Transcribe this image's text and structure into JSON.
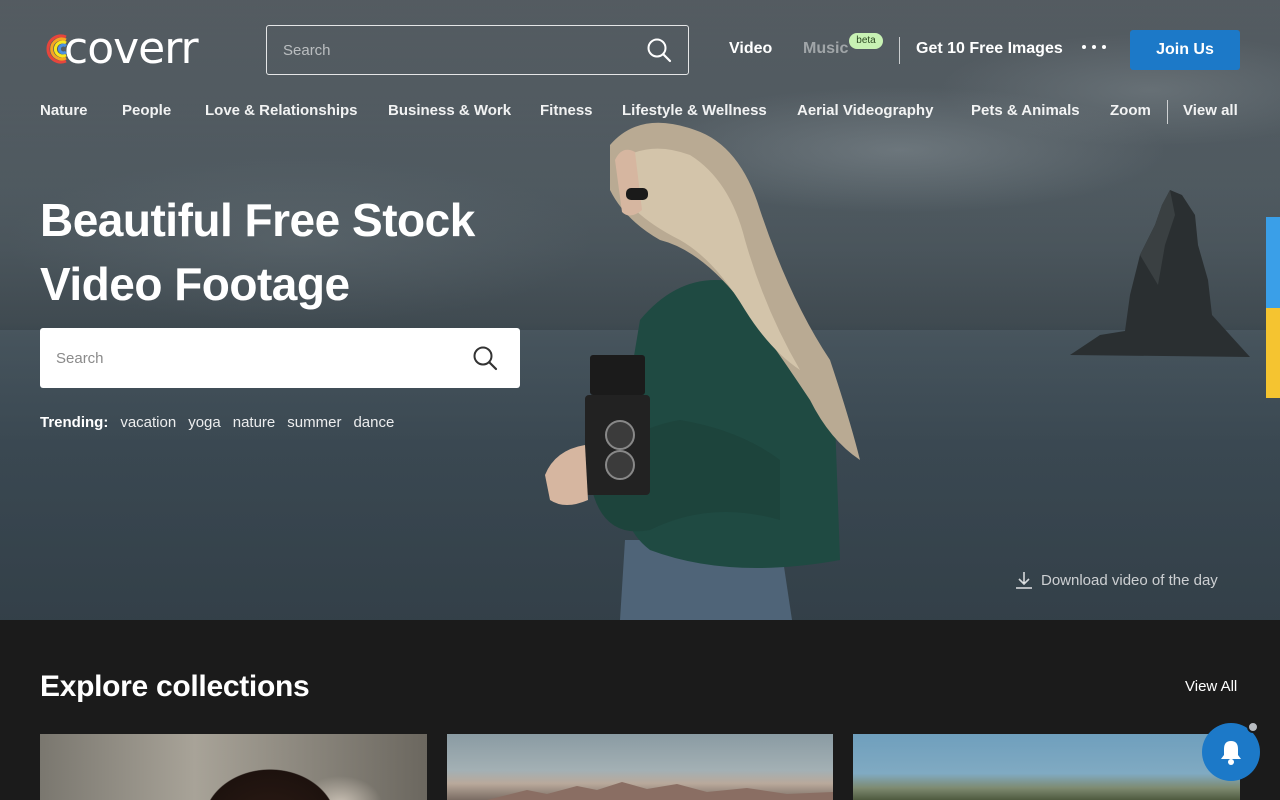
{
  "header": {
    "logo_text": "coverr",
    "search_placeholder": "Search",
    "nav": {
      "video": "Video",
      "music": "Music",
      "music_badge": "beta",
      "free_images": "Get 10 Free Images"
    },
    "join_label": "Join Us"
  },
  "categories": [
    "Nature",
    "People",
    "Love & Relationships",
    "Business & Work",
    "Fitness",
    "Lifestyle & Wellness",
    "Aerial Videography",
    "Pets & Animals",
    "Zoom",
    "View all"
  ],
  "hero": {
    "title_line1": "Beautiful Free Stock",
    "title_line2": "Video Footage",
    "search_placeholder": "Search",
    "trending_label": "Trending:",
    "trending_tags": [
      "vacation",
      "yoga",
      "nature",
      "summer",
      "dance"
    ],
    "download_label": "Download video of the day"
  },
  "collections": {
    "title": "Explore collections",
    "view_all": "View All"
  },
  "colors": {
    "accent": "#1c79c8",
    "page_background": "#1b1b1b",
    "beta_badge": "#c8f2b4",
    "side_tab_blue": "#3a9fe8",
    "side_tab_yellow": "#f5c430"
  },
  "icons": {
    "search": "search-icon",
    "more": "more-horizontal-icon",
    "download": "download-icon",
    "notification": "bell-icon"
  }
}
